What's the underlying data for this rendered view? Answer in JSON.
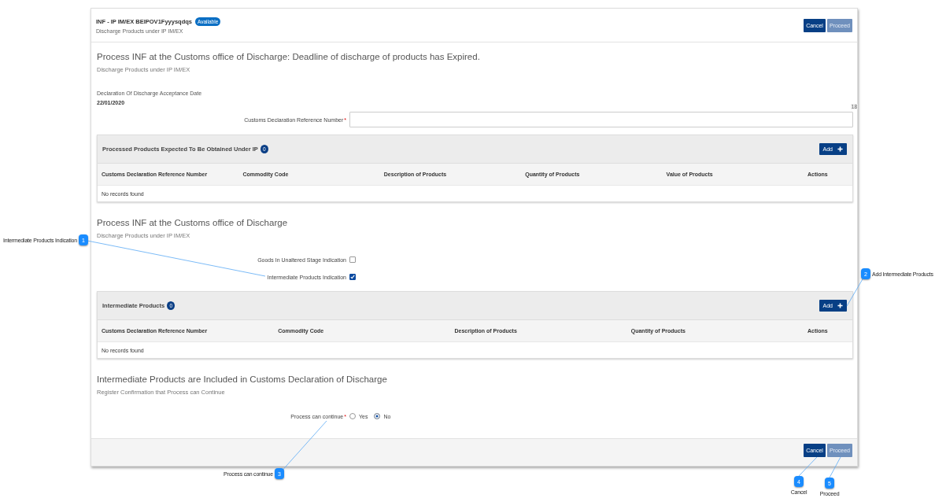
{
  "header": {
    "title": "INF - IP IM/EX BEIPOV1Fyyysqdqs",
    "status_badge": "Available",
    "subtitle": "Discharge Products under IP IM/EX",
    "buttons": [
      {
        "label": "Cancel",
        "disabled": false
      },
      {
        "label": "Proceed",
        "disabled": true
      }
    ]
  },
  "blocks": [
    {
      "kind": "heading",
      "title": "Process INF at the Customs office of Discharge: Deadline of discharge of products has Expired.",
      "subtitle": "Discharge Products under IP IM/EX"
    },
    {
      "kind": "readonly",
      "label": "Declaration Of Discharge Acceptance Date",
      "value": "22/01/2020"
    },
    {
      "kind": "text_field",
      "label": "Customs Declaration Reference Number",
      "required_mark": "*",
      "counter": "18"
    },
    {
      "kind": "table",
      "title": "Processed Products Expected To Be Obtained Under IP",
      "count": "0",
      "add_label": "Add",
      "columns": [
        "Customs Declaration Reference Number",
        "Commodity Code",
        "Description of Products",
        "Quantity of Products",
        "Value of Products",
        "Actions"
      ],
      "empty_text": "No records found"
    },
    {
      "kind": "heading",
      "title": "Process INF at the Customs office of Discharge",
      "subtitle": "Discharge Products under IP IM/EX"
    },
    {
      "kind": "checkbox",
      "label": "Goods In Unaltered Stage Indication",
      "checked": false
    },
    {
      "kind": "checkbox",
      "label": "Intermediate Products Indication",
      "checked": true
    },
    {
      "kind": "table",
      "title": "Intermediate Products",
      "count": "0",
      "add_label": "Add",
      "columns": [
        "Customs Declaration Reference Number",
        "Commodity Code",
        "Description of Products",
        "Quantity of Products",
        "Actions"
      ],
      "empty_text": "No records found"
    },
    {
      "kind": "heading",
      "title": "Intermediate Products are Included in Customs Declaration of Discharge",
      "subtitle": "Register Confirmation that Process can Continue"
    },
    {
      "kind": "radio",
      "label": "Process can continue",
      "required_mark": "*",
      "options": [
        {
          "label": "Yes",
          "selected": false
        },
        {
          "label": "No",
          "selected": true
        }
      ]
    }
  ],
  "footer": {
    "buttons": [
      {
        "label": "Cancel",
        "disabled": false
      },
      {
        "label": "Proceed",
        "disabled": true
      }
    ]
  },
  "callouts": [
    {
      "number": "1",
      "label": "Intermediate Products Indication"
    },
    {
      "number": "2",
      "label": "Add Intermediate Products"
    },
    {
      "number": "3",
      "label": "Process can continue"
    },
    {
      "number": "4",
      "label": "Cancel"
    },
    {
      "number": "5",
      "label": "Proceed"
    }
  ]
}
